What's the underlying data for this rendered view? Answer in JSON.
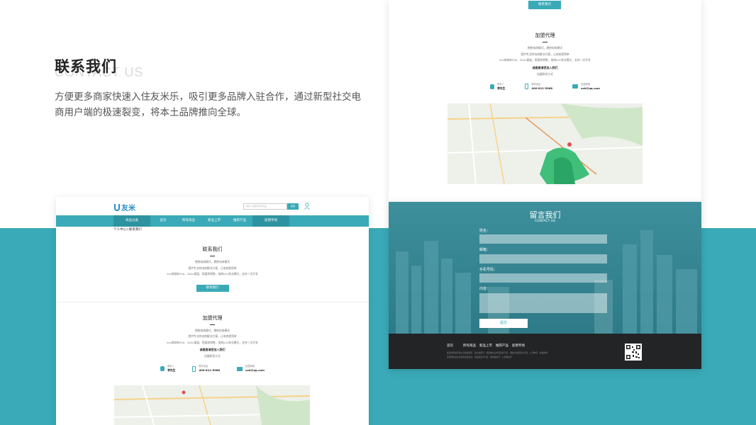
{
  "intro": {
    "title": "联系我们",
    "subtitle": "CONTACT US",
    "description": "方便更多商家快速入住友米乐，吸引更多品牌入驻合作，通过新型社交电商用户端的极速裂变，将本土品牌推向全球。"
  },
  "site": {
    "logo_text": "友米",
    "search_placeholder": "请输入您要搜索的商品",
    "search_button": "搜索",
    "nav": [
      "商品分类",
      "首页",
      "所有商品",
      "新品上市",
      "推荐产品",
      "促销专场"
    ],
    "breadcrumb": "个人中心>联系我们"
  },
  "contact_section": {
    "title": "联系我们",
    "lines": [
      "拥抱电商模式，拥抱电商模式",
      "提供专业的电商解决方案，让电商更简单",
      "ecs商城有S2b、2b2c渠道，帮渠商销售，电商b2c商业模式，支持二次开发"
    ],
    "button": "联系我们"
  },
  "join_section": {
    "title": "加盟代理",
    "lines": [
      "拥抱电商模式，拥抱电商模式",
      "提供专业的电商解决方案，让电商更简单",
      "ecs商城有S2b、2b2c渠道，帮渠商销售，电商b2c商业模式，支持二次开发"
    ],
    "invite_title": "诚邀邀请您加入我们",
    "invite_sub": "加盟联系方式",
    "contacts": [
      {
        "label": "联系人",
        "value": "李先生"
      },
      {
        "label": "联系电话",
        "value": "400-811-5968"
      },
      {
        "label": "加盟邮箱",
        "value": "xzh@qq.com"
      }
    ]
  },
  "message_form": {
    "title": "留言我们",
    "subtitle": "CONTACT US",
    "fields": [
      "姓名：",
      "邮箱：",
      "手机号码：",
      "内容："
    ],
    "submit": "提交"
  },
  "footer": {
    "nav": [
      "首页",
      "所有商品",
      "新品上市",
      "推荐产品",
      "促销专场"
    ],
    "line1": "美丽妆科技有限公司版权所有 · 营业执照号 · 增值电信业务经营许可证 · 网络文化经营许可证 · 公司电话 · 客服热线",
    "line2": "互联网药品信息服务资格证书 · 食品经营许可证 · 网站备案号 · 公安备案号"
  },
  "colors": {
    "accent": "#3aaab8",
    "footer_bg": "#222426"
  }
}
